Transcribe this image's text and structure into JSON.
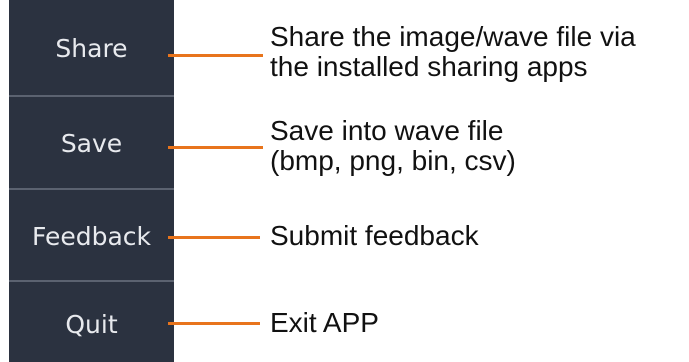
{
  "menu": {
    "items": [
      {
        "label": "Share"
      },
      {
        "label": "Save"
      },
      {
        "label": "Feedback"
      },
      {
        "label": "Quit"
      }
    ]
  },
  "callouts": [
    {
      "line1": "Share the image/wave file via",
      "line2": "the installed sharing apps"
    },
    {
      "line1": "Save into wave file",
      "line2": "(bmp, png, bin, csv)"
    },
    {
      "line1": "Submit feedback"
    },
    {
      "line1": "Exit APP"
    }
  ],
  "colors": {
    "menu_background": "#2b3240",
    "menu_text": "#e8eaee",
    "divider": "#5b6270",
    "arrow": "#e8741c"
  }
}
